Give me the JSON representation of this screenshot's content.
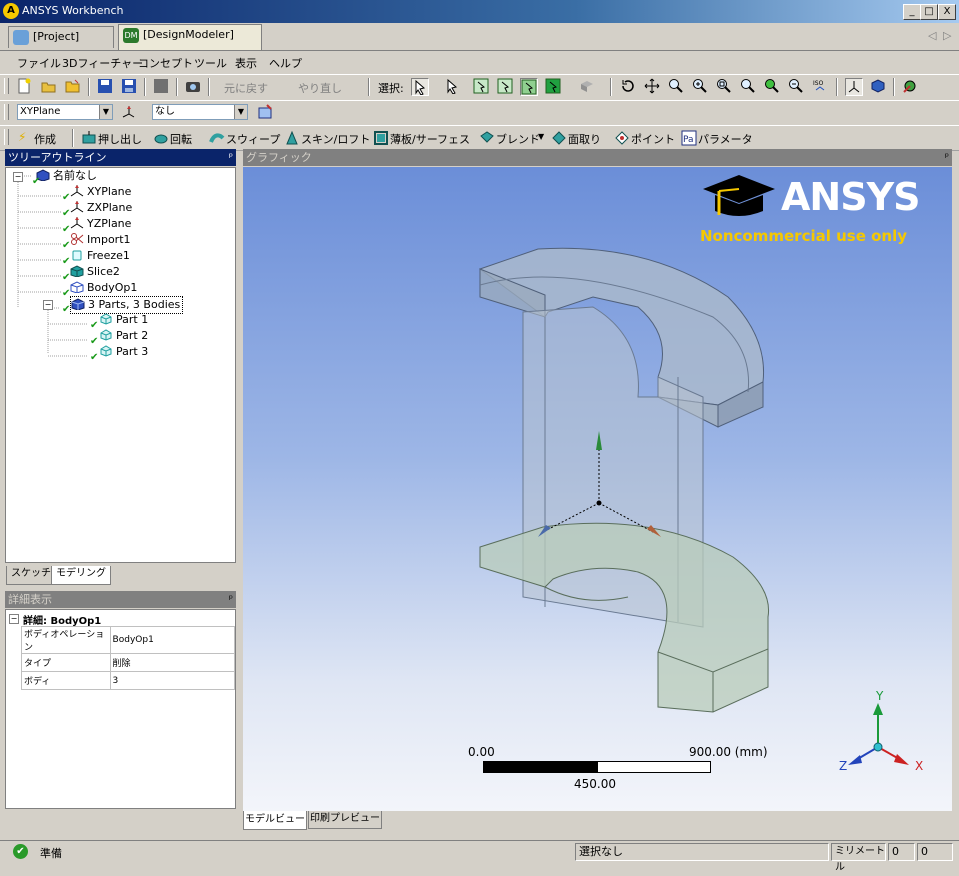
{
  "window": {
    "title": "ANSYS Workbench",
    "logo_letter": "A",
    "minimize": "_",
    "maximize": "□",
    "close": "X"
  },
  "tabs": [
    {
      "label": "[Project]"
    },
    {
      "label": "[DesignModeler]",
      "icon_text": "DM"
    }
  ],
  "tab_nav": {
    "prev": "◁",
    "next": "▷"
  },
  "menu": [
    "ファイル",
    "3Dフィーチャー",
    "コンセプト",
    "ツール",
    "表示",
    "ヘルプ"
  ],
  "toolbar1": {
    "undo": "元に戻す",
    "redo": "やり直し",
    "select": "選択:"
  },
  "toolbar2": {
    "plane_value": "XYPlane",
    "sketch_value": "なし"
  },
  "toolbar3": {
    "generate": "作成",
    "extrude": "押し出し",
    "revolve": "回転",
    "sweep": "スウィープ",
    "skin": "スキン/ロフト",
    "thin": "薄板/サーフェス",
    "blend": "ブレンド",
    "chamfer": "面取り",
    "point": "ポイント",
    "parameter": "パラメータ"
  },
  "tree_panel": {
    "title": "ツリーアウトライン",
    "pin": "ᵖ"
  },
  "tree": [
    {
      "label": "名前なし",
      "icon": "root-icon",
      "color": "#3050c0"
    },
    {
      "label": "XYPlane",
      "icon": "plane-icon",
      "color": "#c03030"
    },
    {
      "label": "ZXPlane",
      "icon": "plane-icon",
      "color": "#c03030"
    },
    {
      "label": "YZPlane",
      "icon": "plane-icon",
      "color": "#c03030"
    },
    {
      "label": "Import1",
      "icon": "import-icon",
      "color": "#b03030"
    },
    {
      "label": "Freeze1",
      "icon": "freeze-icon",
      "color": "#20a0a0"
    },
    {
      "label": "Slice2",
      "icon": "slice-icon",
      "color": "#20a0a0"
    },
    {
      "label": "BodyOp1",
      "icon": "bodyop-icon",
      "color": "#3050c0"
    },
    {
      "label": "3 Parts, 3 Bodies",
      "icon": "parts-icon",
      "color": "#3050c0"
    },
    {
      "label": "Part 1",
      "icon": "part-icon",
      "color": "#20a0a0"
    },
    {
      "label": "Part 2",
      "icon": "part-icon",
      "color": "#20a0a0"
    },
    {
      "label": "Part 3",
      "icon": "part-icon",
      "color": "#20a0a0"
    }
  ],
  "tree_tabs": [
    "スケッチ",
    "モデリング"
  ],
  "details_panel": {
    "title": "詳細表示",
    "pin": "ᵖ"
  },
  "details": {
    "header": "詳細: BodyOp1",
    "rows": [
      {
        "key": "ボディオペレーション",
        "value": "BodyOp1"
      },
      {
        "key": "タイプ",
        "value": "削除"
      },
      {
        "key": "ボディ",
        "value": "3"
      }
    ]
  },
  "graphics": {
    "title": "グラフィック",
    "pin": "ᵖ",
    "brand": "ANSYS",
    "brand_note": "Noncommercial use only",
    "scale_left": "0.00",
    "scale_right": "900.00 (mm)",
    "scale_mid": "450.00",
    "axis_y": "Y",
    "axis_z": "Z",
    "axis_x": "X",
    "bottom_tabs": [
      "モデルビュー",
      "印刷プレビュー"
    ]
  },
  "status": {
    "state": "準備",
    "selection": "選択なし",
    "units": "ミリメートル",
    "x": "0",
    "y": "0"
  }
}
